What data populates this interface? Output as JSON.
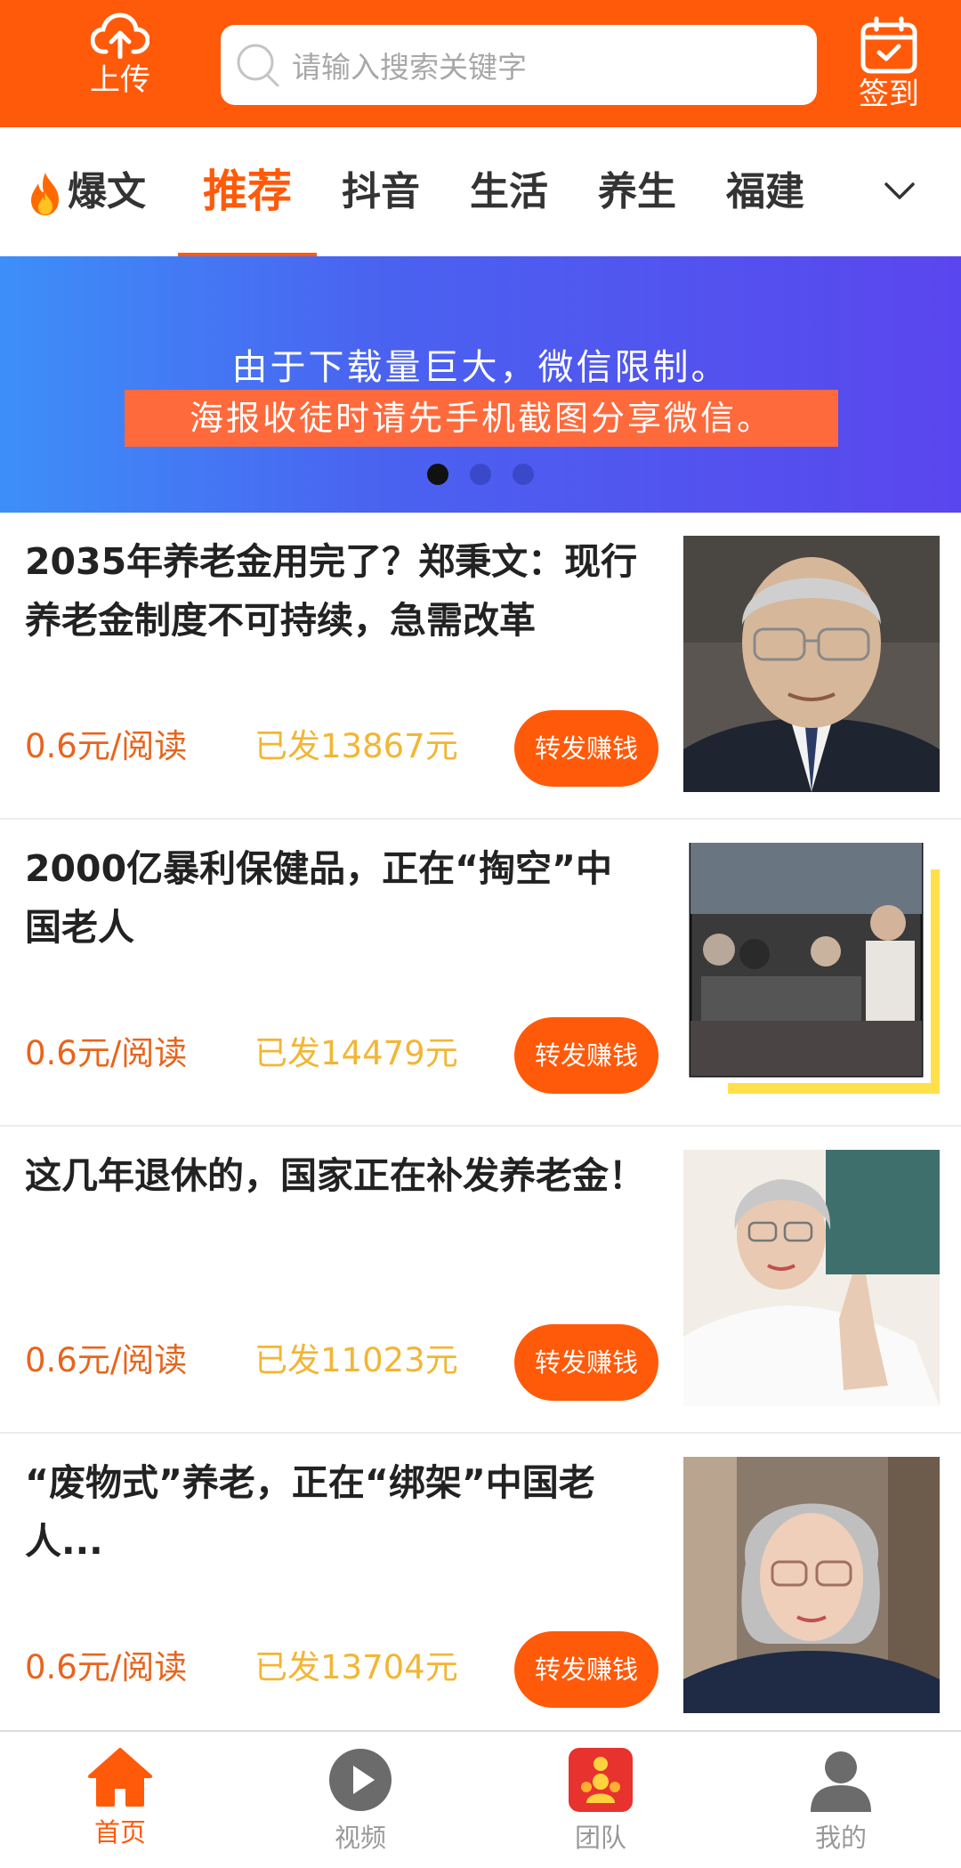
{
  "header": {
    "upload_label": "上传",
    "search_placeholder": "请输入搜索关键字",
    "signin_label": "签到"
  },
  "tabs": [
    {
      "label": "爆文",
      "icon": "fire-icon"
    },
    {
      "label": "推荐",
      "active": true
    },
    {
      "label": "抖音"
    },
    {
      "label": "生活"
    },
    {
      "label": "养生"
    },
    {
      "label": "福建"
    }
  ],
  "banner": {
    "line1": "由于下载量巨大，微信限制。",
    "line2": "海报收徒时请先手机截图分享微信。",
    "slide_count": 3,
    "active_slide": 1
  },
  "articles": [
    {
      "title": "2035年养老金用完了？郑秉文：现行养老金制度不可持续，急需改革",
      "price": "0.6元/阅读",
      "sent": "已发13867元",
      "button": "转发赚钱"
    },
    {
      "title": "2000亿暴利保健品，正在“掏空”中国老人",
      "price": "0.6元/阅读",
      "sent": "已发14479元",
      "button": "转发赚钱"
    },
    {
      "title": "这几年退休的，国家正在补发养老金！",
      "price": "0.6元/阅读",
      "sent": "已发11023元",
      "button": "转发赚钱"
    },
    {
      "title": "“废物式”养老，正在“绑架”中国老人...",
      "price": "0.6元/阅读",
      "sent": "已发13704元",
      "button": "转发赚钱"
    }
  ],
  "bottom_nav": [
    {
      "label": "首页",
      "icon": "home-icon",
      "active": true
    },
    {
      "label": "视频",
      "icon": "play-icon"
    },
    {
      "label": "团队",
      "icon": "team-icon"
    },
    {
      "label": "我的",
      "icon": "user-icon"
    }
  ],
  "colors": {
    "brand": "#ff5a0a",
    "price": "#e8641c",
    "sent": "#f2b634"
  }
}
